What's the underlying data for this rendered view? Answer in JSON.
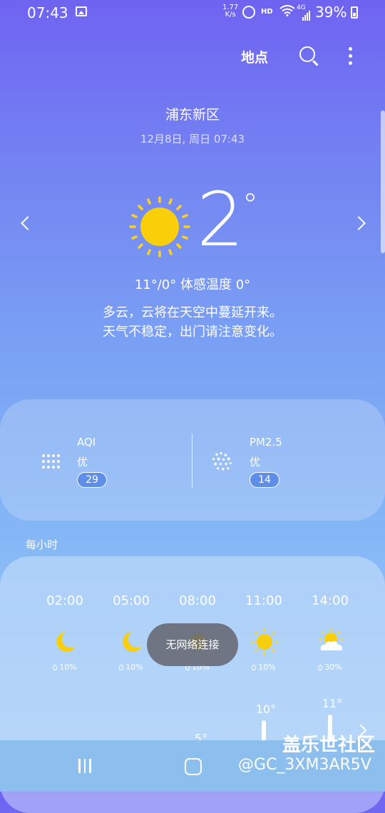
{
  "status_bar": {
    "time": "07:43",
    "speed_value": "1.77",
    "speed_unit": "K/s",
    "hd": "HD",
    "network": "4G",
    "battery": "39%"
  },
  "header": {
    "places_label": "地点"
  },
  "location": {
    "name": "浦东新区",
    "datetime": "12月8日, 周日 07:43"
  },
  "current": {
    "temperature": "2",
    "unit": "°",
    "range_feels": "11°/0° 体感温度 0°",
    "description_line1": "多云，云将在天空中蔓延开来。",
    "description_line2": "天气不稳定，出门请注意变化。"
  },
  "air": {
    "aqi": {
      "label": "AQI",
      "level": "优",
      "value": "29"
    },
    "pm25": {
      "label": "PM2.5",
      "level": "优",
      "value": "14"
    }
  },
  "hourly": {
    "title": "每小时",
    "items": [
      {
        "time": "02:00",
        "icon": "moon-icon",
        "precip": "10%"
      },
      {
        "time": "05:00",
        "icon": "moon-icon",
        "precip": "10%"
      },
      {
        "time": "08:00",
        "icon": "sun-icon",
        "precip": "10%"
      },
      {
        "time": "11:00",
        "icon": "sun-icon",
        "precip": "10%"
      },
      {
        "time": "14:00",
        "icon": "partly-cloudy-icon",
        "precip": "30%"
      }
    ],
    "temps": [
      "5°",
      "10°",
      "11°"
    ]
  },
  "toast": "无网络连接",
  "watermark": {
    "title": "盖乐世社区",
    "id": "@GC_3XM3AR5V"
  },
  "colors": {
    "badge": "#5e8ee8",
    "sun": "#f9cf0a",
    "sun_ray": "#ffd11a"
  }
}
